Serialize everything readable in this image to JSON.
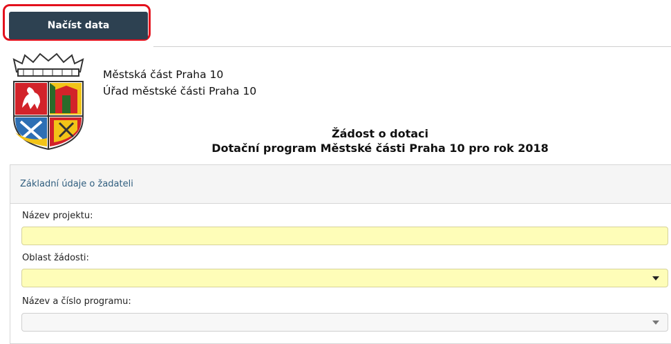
{
  "toolbar": {
    "load_button_label": "Načíst data"
  },
  "header": {
    "office_line1": "Městská část Praha 10",
    "office_line2": "Úřad městské části Praha 10",
    "title_line1": "Žádost o dotaci",
    "title_line2": "Dotační program Městské části Praha 10 pro rok 2018"
  },
  "section": {
    "title": "Základní údaje o žadateli",
    "fields": [
      {
        "label": "Název projektu:",
        "value": ""
      },
      {
        "label": "Oblast žádosti:",
        "value": ""
      },
      {
        "label": "Název a číslo programu:",
        "value": ""
      }
    ]
  },
  "colors": {
    "button_bg": "#2d4151",
    "highlight_border": "#e3101c",
    "required_field_bg": "#fefdb8",
    "section_title": "#2f5d7e"
  },
  "icons": {
    "logo": "praha-10-coat-of-arms-icon",
    "dropdown": "chevron-down-icon"
  }
}
